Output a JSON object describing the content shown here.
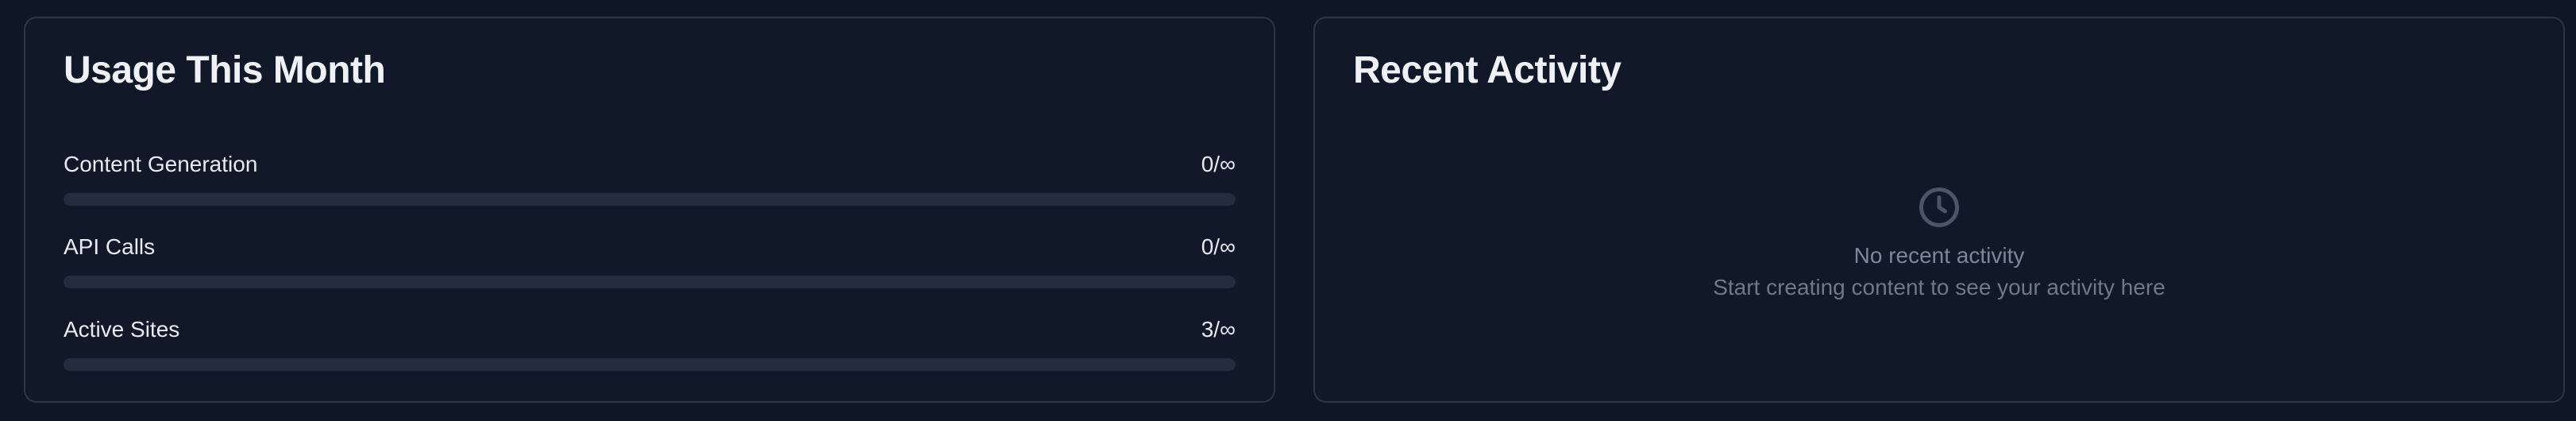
{
  "usage_card": {
    "title": "Usage This Month",
    "items": [
      {
        "label": "Content Generation",
        "value": "0/∞",
        "progress_fraction": 0
      },
      {
        "label": "API Calls",
        "value": "0/∞",
        "progress_fraction": 0
      },
      {
        "label": "Active Sites",
        "value": "3/∞",
        "progress_fraction": 0
      }
    ]
  },
  "activity_card": {
    "title": "Recent Activity",
    "empty_icon": "clock-icon",
    "empty_title": "No recent activity",
    "empty_subtitle": "Start creating content to see your activity here"
  },
  "colors": {
    "page_background": "#0f1626",
    "card_background": "#111828",
    "card_border": "#2c3646",
    "track": "#232c3c",
    "muted_text": "#7d8797"
  }
}
